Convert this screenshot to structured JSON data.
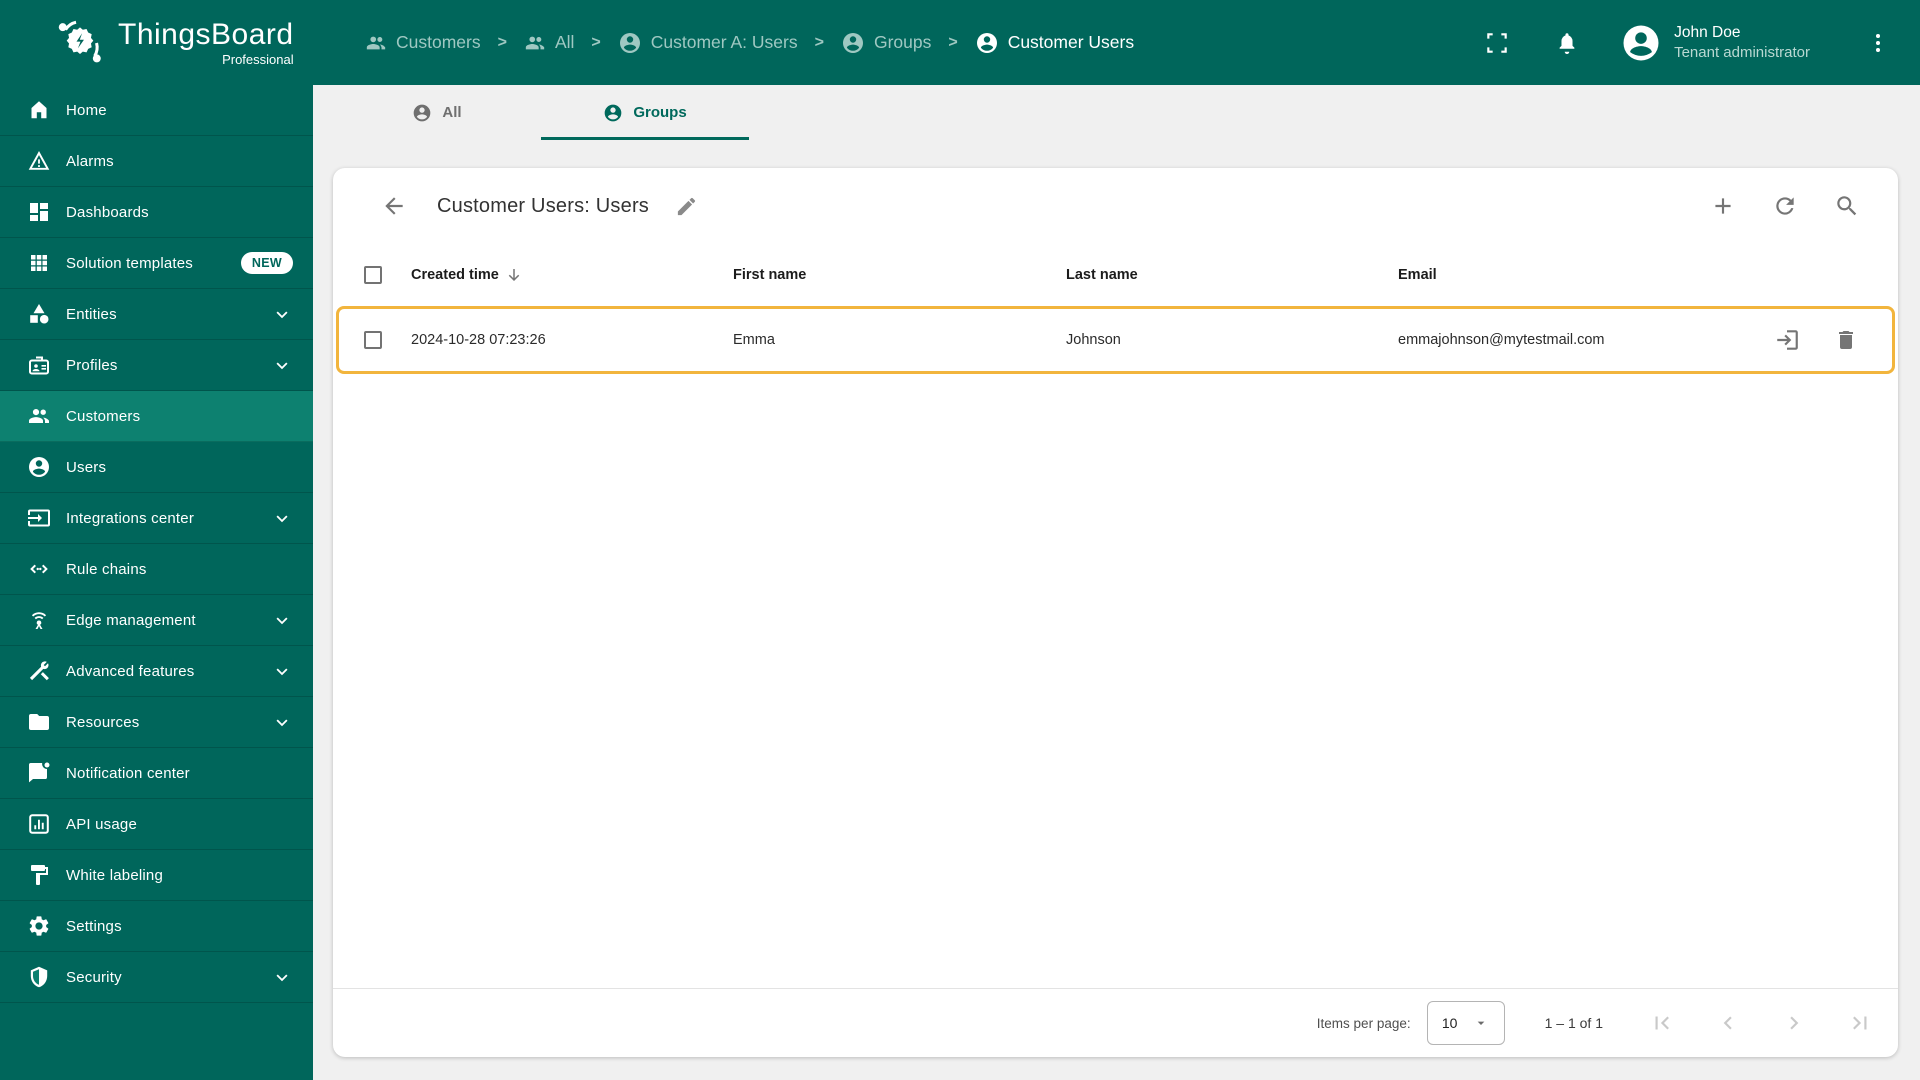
{
  "brand": {
    "name": "ThingsBoard",
    "edition": "Professional"
  },
  "header": {
    "breadcrumb_separator": ">",
    "breadcrumb": [
      {
        "label": "Customers",
        "icon": "people"
      },
      {
        "label": "All",
        "icon": "people"
      },
      {
        "label": "Customer A: Users",
        "icon": "account-circle"
      },
      {
        "label": "Groups",
        "icon": "account-circle"
      },
      {
        "label": "Customer Users",
        "icon": "account-circle"
      }
    ],
    "user": {
      "name": "John Doe",
      "role": "Tenant administrator"
    }
  },
  "sidebar": {
    "items": [
      {
        "label": "Home",
        "icon": "home"
      },
      {
        "label": "Alarms",
        "icon": "warning"
      },
      {
        "label": "Dashboards",
        "icon": "dashboard"
      },
      {
        "label": "Solution templates",
        "icon": "apps",
        "badge": "NEW"
      },
      {
        "label": "Entities",
        "icon": "category",
        "expandable": true
      },
      {
        "label": "Profiles",
        "icon": "badge",
        "expandable": true
      },
      {
        "label": "Customers",
        "icon": "people",
        "active": true
      },
      {
        "label": "Users",
        "icon": "account-circle"
      },
      {
        "label": "Integrations center",
        "icon": "input",
        "expandable": true
      },
      {
        "label": "Rule chains",
        "icon": "settings-ethernet"
      },
      {
        "label": "Edge management",
        "icon": "router",
        "expandable": true
      },
      {
        "label": "Advanced features",
        "icon": "construction",
        "expandable": true
      },
      {
        "label": "Resources",
        "icon": "folder",
        "expandable": true
      },
      {
        "label": "Notification center",
        "icon": "notification",
        "expandable": false
      },
      {
        "label": "API usage",
        "icon": "insert-chart"
      },
      {
        "label": "White labeling",
        "icon": "format-paint"
      },
      {
        "label": "Settings",
        "icon": "settings"
      },
      {
        "label": "Security",
        "icon": "security",
        "expandable": true
      }
    ]
  },
  "tabs": [
    {
      "label": "All"
    },
    {
      "label": "Groups",
      "active": true
    }
  ],
  "panel": {
    "title": "Customer Users: Users",
    "table": {
      "columns": {
        "created": "Created time",
        "first": "First name",
        "last": "Last name",
        "email": "Email"
      },
      "sort": {
        "column": "Created time",
        "direction": "desc"
      },
      "rows": [
        {
          "created": "2024-10-28 07:23:26",
          "first": "Emma",
          "last": "Johnson",
          "email": "emmajohnson@mytestmail.com",
          "checked": false,
          "highlighted": true
        }
      ]
    },
    "pagination": {
      "items_per_page_label": "Items per page:",
      "page_size": "10",
      "range": "1 – 1 of 1"
    }
  },
  "colors": {
    "primary": "#00665b",
    "sidebar_active": "#0d8170",
    "tab_active": "#00695c",
    "row_highlight_border": "#f2b53d",
    "page_background": "#f0f0f0"
  }
}
